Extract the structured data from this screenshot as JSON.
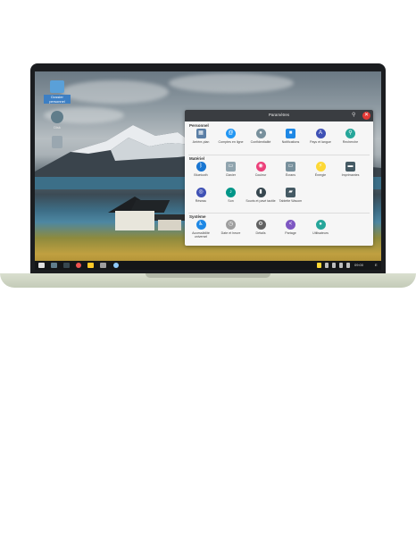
{
  "desktop": {
    "icons": [
      {
        "label": "Dossier personnel"
      },
      {
        "label": "Disk"
      },
      {
        "label": ""
      }
    ]
  },
  "launcher": {
    "title": "Paramètres",
    "sections": [
      {
        "title": "Personnel",
        "apps": [
          {
            "label": "Arrière-plan",
            "icon": "wallpaper-icon",
            "color": "#5b7fa6"
          },
          {
            "label": "Comptes en ligne",
            "icon": "at-icon",
            "color": "#2196f3"
          },
          {
            "label": "Confidentialité",
            "icon": "privacy-icon",
            "color": "#78909c"
          },
          {
            "label": "Notifications",
            "icon": "notifications-icon",
            "color": "#1e88e5"
          },
          {
            "label": "Pays et langue",
            "icon": "language-icon",
            "color": "#3f51b5"
          },
          {
            "label": "Recherche",
            "icon": "search-icon",
            "color": "#26a69a"
          }
        ]
      },
      {
        "title": "Matériel",
        "apps": [
          {
            "label": "Bluetooth",
            "icon": "bluetooth-icon",
            "color": "#1976d2"
          },
          {
            "label": "Clavier",
            "icon": "keyboard-icon",
            "color": "#90a4ae"
          },
          {
            "label": "Couleur",
            "icon": "color-icon",
            "color": "#ec407a"
          },
          {
            "label": "Écrans",
            "icon": "display-icon",
            "color": "#78909c"
          },
          {
            "label": "Énergie",
            "icon": "power-icon",
            "color": "#fdd835"
          },
          {
            "label": "Imprimantes",
            "icon": "printer-icon",
            "color": "#455a64"
          },
          {
            "label": "Réseau",
            "icon": "network-icon",
            "color": "#3f51b5"
          },
          {
            "label": "Son",
            "icon": "sound-icon",
            "color": "#009688"
          },
          {
            "label": "Souris et pavé tactile",
            "icon": "mouse-icon",
            "color": "#37474f"
          },
          {
            "label": "Tablette Wacom",
            "icon": "tablet-icon",
            "color": "#455a64"
          }
        ]
      },
      {
        "title": "Système",
        "apps": [
          {
            "label": "Accessibilité universel",
            "icon": "accessibility-icon",
            "color": "#1e88e5"
          },
          {
            "label": "Date et heure",
            "icon": "clock-icon",
            "color": "#9e9e9e"
          },
          {
            "label": "Détails",
            "icon": "gear-icon",
            "color": "#616161"
          },
          {
            "label": "Partage",
            "icon": "share-icon",
            "color": "#7e57c2"
          },
          {
            "label": "Utilisateurs",
            "icon": "user-icon",
            "color": "#26a69a"
          }
        ]
      }
    ]
  },
  "taskbar": {
    "time": "09:00",
    "battery_label": "E"
  }
}
